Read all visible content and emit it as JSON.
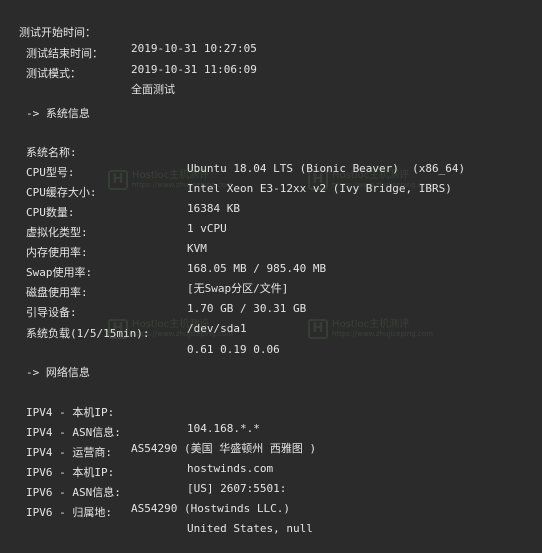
{
  "header": [
    {
      "label": "测试开始时间：",
      "value": "2019-10-31 10:27:05"
    },
    {
      "label": "测试结束时间：",
      "value": "2019-10-31 11:06:09"
    },
    {
      "label": "测试模式：",
      "value": "全面测试"
    }
  ],
  "sections": {
    "system_title": "-> 系统信息",
    "network_title": "-> 网络信息"
  },
  "system": [
    {
      "label": "系统名称:",
      "value": "Ubuntu 18.04 LTS (Bionic Beaver)  (x86_64)"
    },
    {
      "label": "CPU型号:",
      "value": "Intel Xeon E3-12xx v2 (Ivy Bridge, IBRS)"
    },
    {
      "label": "CPU缓存大小:",
      "value": "16384 KB"
    },
    {
      "label": "CPU数量:",
      "value": "1 vCPU"
    },
    {
      "label": "虚拟化类型:",
      "value": "KVM"
    },
    {
      "label": "内存使用率:",
      "value": "168.05 MB / 985.40 MB"
    },
    {
      "label": "Swap使用率:",
      "value": "[无Swap分区/文件]"
    },
    {
      "label": "磁盘使用率:",
      "value": "1.70 GB / 30.31 GB"
    },
    {
      "label": "引导设备:",
      "value": "/dev/sda1"
    },
    {
      "label": "系统负载(1/5/15min):",
      "value": "0.61 0.19 0.06"
    }
  ],
  "network": [
    {
      "label": "IPV4 - 本机IP:",
      "value": "104.168.*.*"
    },
    {
      "label": "IPV4 - ASN信息:",
      "value": "AS54290 (美国 华盛顿州 西雅图 )"
    },
    {
      "label": "IPV4 - 运营商:",
      "value": "hostwinds.com"
    },
    {
      "label": "IPV6 - 本机IP:",
      "value": "[US] 2607:5501:"
    },
    {
      "label": "IPV6 - ASN信息:",
      "value": "AS54290 (Hostwinds LLC.)"
    },
    {
      "label": "IPV6 - 归属地:",
      "value": "United States, null"
    }
  ],
  "watermark": {
    "logo": "H",
    "name": "Hostloc主机测评",
    "url": "https://www.zhujiceping.com"
  },
  "colors": {
    "background": "#2b2b2b",
    "text": "#e4e4e4",
    "watermark": "#7fc07f"
  }
}
